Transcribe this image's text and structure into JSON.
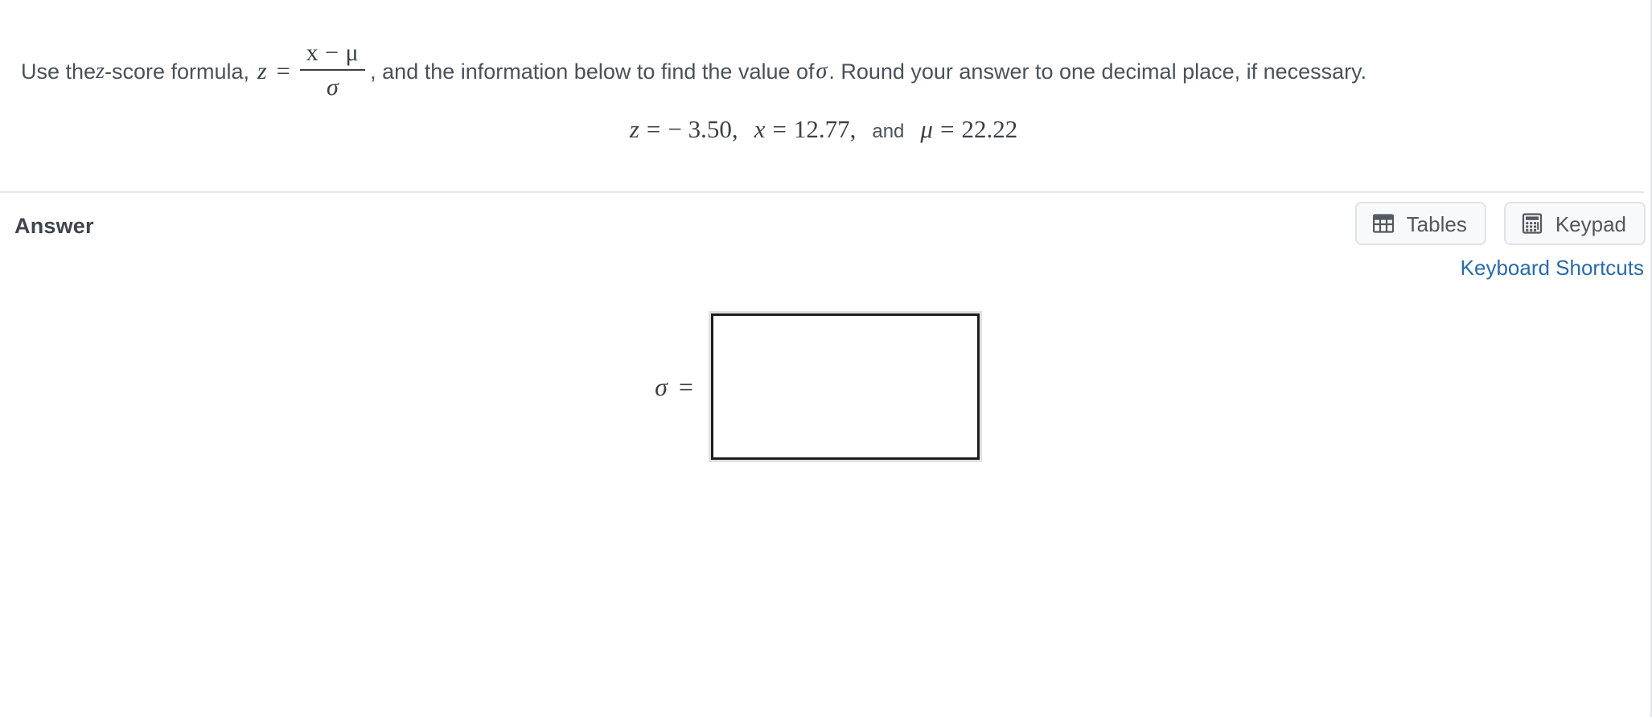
{
  "question": {
    "prefix": "Use the ",
    "z_symbol": "z",
    "after_z": "-score formula, ",
    "formula_var": "z",
    "formula_eq": "=",
    "formula_numerator": "x − μ",
    "formula_denominator": "σ",
    "middle": ", and the information below to find the value of ",
    "target_symbol": "σ",
    "suffix": ". Round your answer to one decimal place, if necessary."
  },
  "given": {
    "z_label": "z",
    "z_eq": "=",
    "z_value": "− 3.50,",
    "x_label": "x",
    "x_eq": "=",
    "x_value": "12.77,",
    "and": "and",
    "mu_label": "μ",
    "mu_eq": "=",
    "mu_value": "22.22"
  },
  "answer_section": {
    "label": "Answer",
    "tables_button": "Tables",
    "keypad_button": "Keypad",
    "keyboard_shortcuts": "Keyboard Shortcuts",
    "result_symbol": "σ",
    "result_eq": "=",
    "input_value": "",
    "input_placeholder": ""
  },
  "colors": {
    "text": "#4a5159",
    "math": "#3c4044",
    "link": "#2a6aa8",
    "button_bg": "#f8f9fa",
    "button_border": "#dfe3e8",
    "divider": "#e5e7ea",
    "input_border": "#1d1d1d"
  }
}
